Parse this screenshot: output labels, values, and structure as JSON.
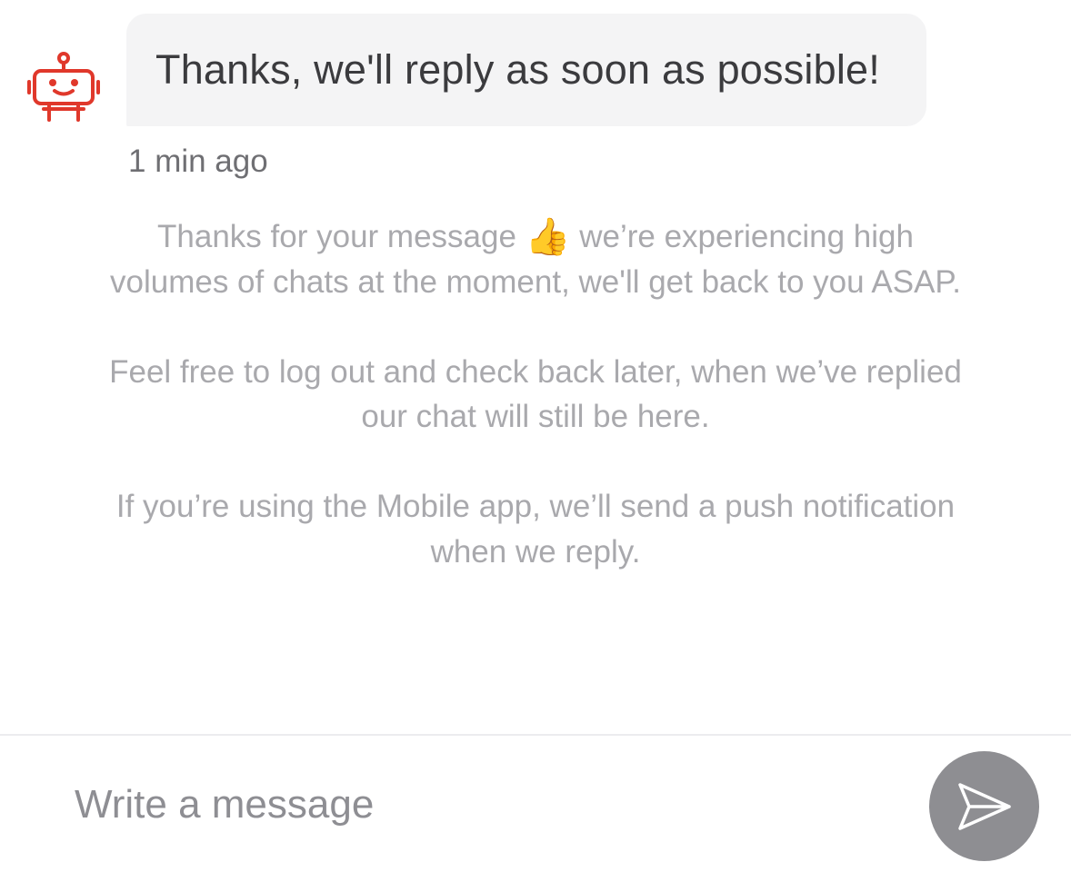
{
  "chat": {
    "bot_message": "Thanks, we'll reply as soon as possible!",
    "timestamp": "1 min ago",
    "notice": {
      "line_1_before_emoji": "Thanks for your message",
      "emoji": "👍",
      "line_1_after_emoji": "we’re experiencing high volumes of chats at the moment, we'll get back to you ASAP.",
      "paragraph_2": "Feel free to log out and check back later, when we’ve replied our chat will still be here.",
      "paragraph_3": "If you’re using the Mobile app, we’ll send a push notification when we reply."
    }
  },
  "composer": {
    "placeholder": "Write a message",
    "value": ""
  },
  "icons": {
    "avatar": "robot-icon",
    "send": "paper-plane-send-icon"
  },
  "colors": {
    "bot_accent": "#e0382b",
    "bubble_bg": "#f4f4f5",
    "bubble_text": "#3b3b3e",
    "notice_text": "#a9a9ad",
    "send_button_bg": "#8e8e92"
  }
}
